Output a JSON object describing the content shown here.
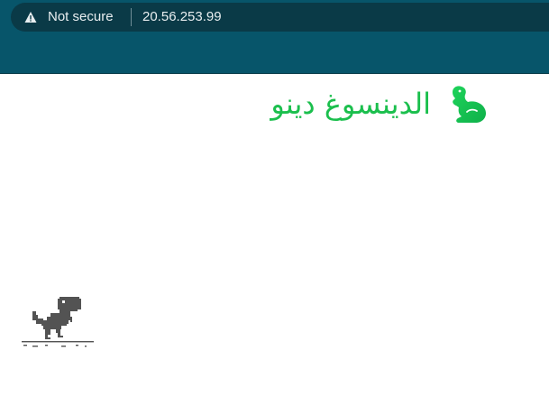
{
  "browser": {
    "security_label": "Not secure",
    "url": "20.56.253.99",
    "icons": {
      "security": "warning-triangle-icon"
    }
  },
  "site": {
    "title": "الدينسوغ دينو",
    "logo_icon": "dinosaur-logo-icon",
    "accent_color": "#1bbf4d"
  },
  "game": {
    "character_icon": "t-rex-icon",
    "character_color": "#535353"
  },
  "colors": {
    "toolbar": "#07556a",
    "address_bar": "#0a3a47"
  }
}
